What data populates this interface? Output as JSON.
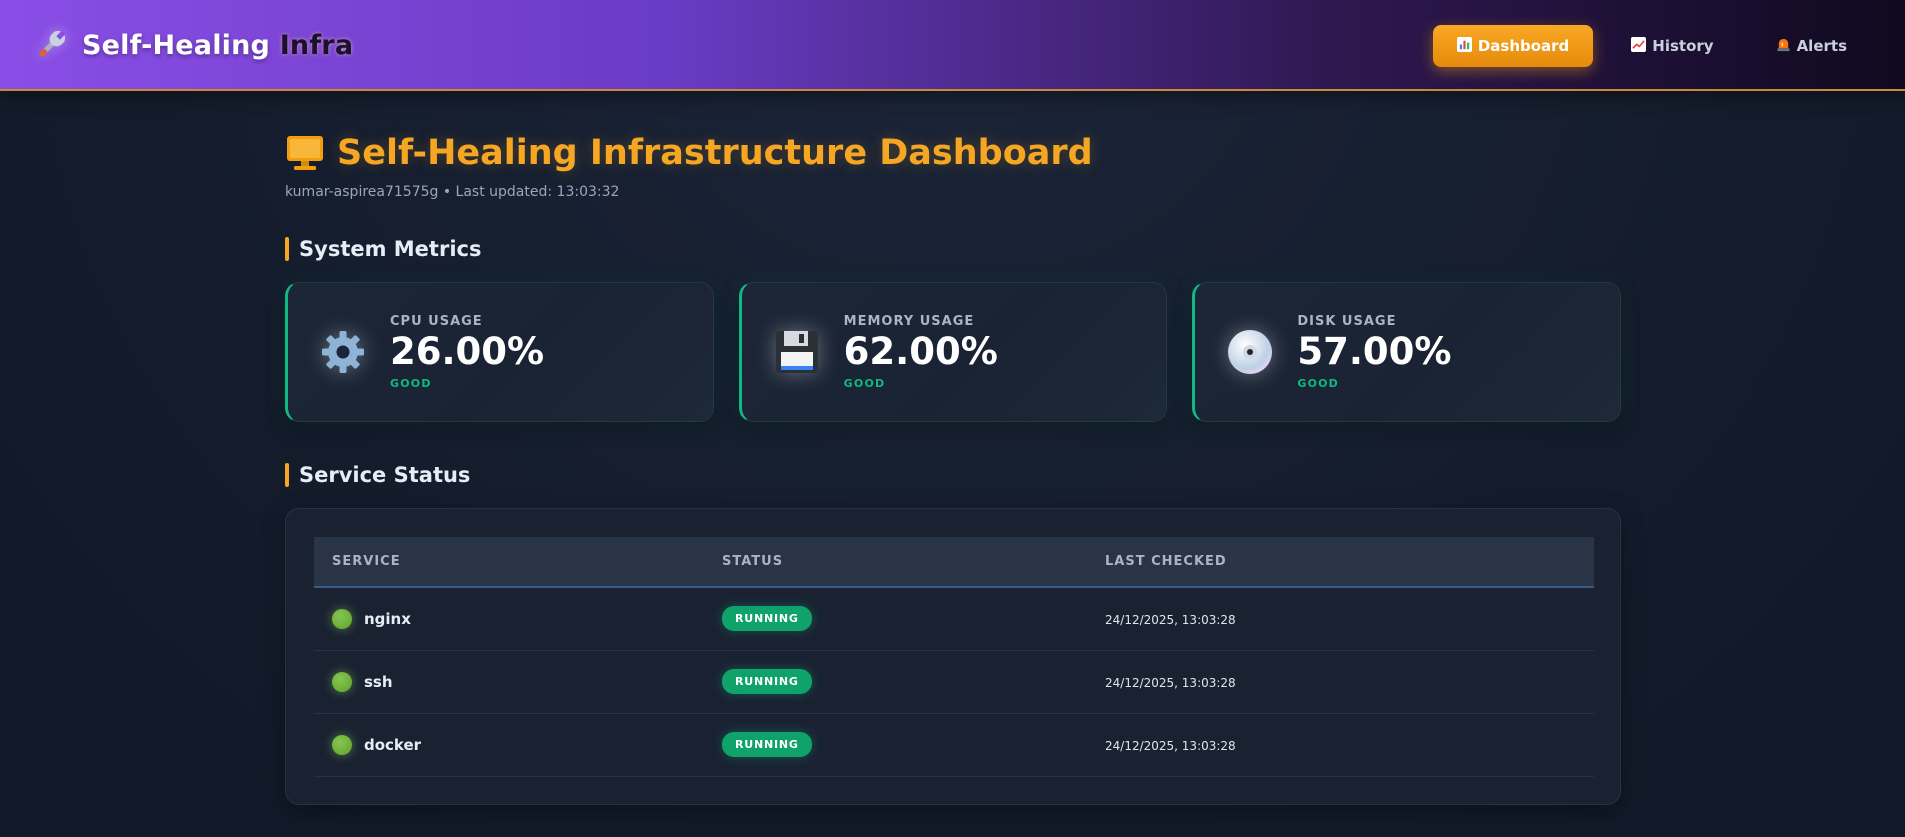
{
  "header": {
    "brand_main": "Self-Healing",
    "brand_accent": "Infra",
    "brand_icon": "wrench-icon",
    "nav": [
      {
        "label": "Dashboard",
        "icon": "bar-chart-icon",
        "active": true
      },
      {
        "label": "History",
        "icon": "line-chart-icon",
        "active": false
      },
      {
        "label": "Alerts",
        "icon": "siren-icon",
        "active": false
      }
    ]
  },
  "page": {
    "title": "Self-Healing Infrastructure Dashboard",
    "title_icon": "monitor-icon",
    "subtitle": "kumar-aspirea71575g • Last updated: 13:03:32"
  },
  "metrics_section": {
    "title": "System Metrics",
    "cards": [
      {
        "label": "CPU USAGE",
        "value": "26.00%",
        "status": "GOOD",
        "icon": "gear-icon"
      },
      {
        "label": "MEMORY USAGE",
        "value": "62.00%",
        "status": "GOOD",
        "icon": "floppy-disk-icon"
      },
      {
        "label": "DISK USAGE",
        "value": "57.00%",
        "status": "GOOD",
        "icon": "optical-disc-icon"
      }
    ]
  },
  "services_section": {
    "title": "Service Status",
    "columns": [
      "SERVICE",
      "STATUS",
      "LAST CHECKED"
    ],
    "rows": [
      {
        "name": "nginx",
        "status": "RUNNING",
        "last_checked": "24/12/2025, 13:03:28"
      },
      {
        "name": "ssh",
        "status": "RUNNING",
        "last_checked": "24/12/2025, 13:03:28"
      },
      {
        "name": "docker",
        "status": "RUNNING",
        "last_checked": "24/12/2025, 13:03:28"
      }
    ]
  },
  "colors": {
    "accent": "#f5a623",
    "good": "#10b981",
    "running_dot": "#7cbc48"
  }
}
